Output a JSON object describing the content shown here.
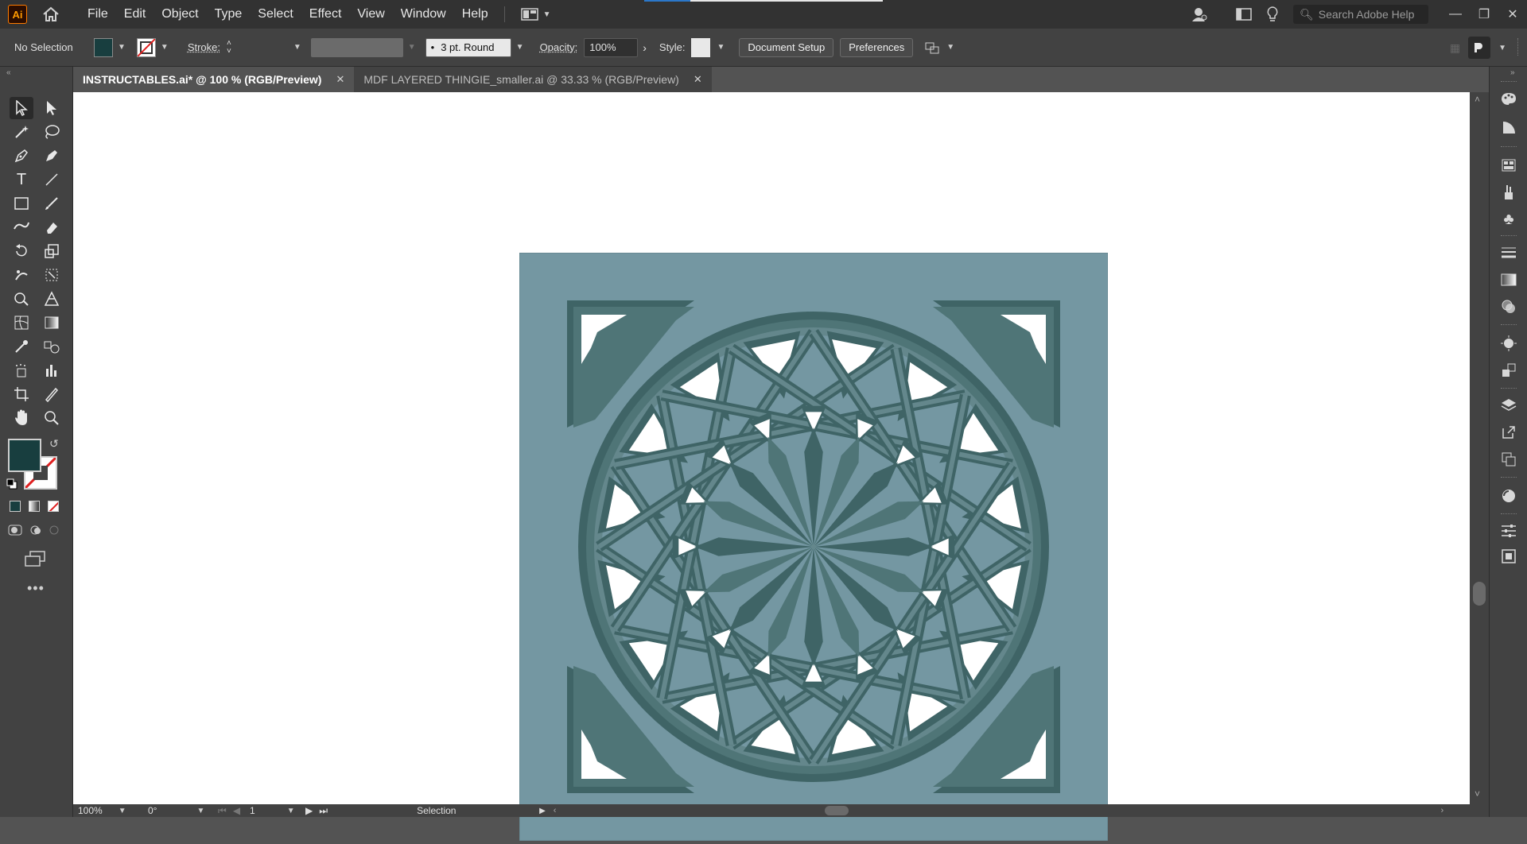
{
  "app": {
    "logo_text": "Ai"
  },
  "menu": [
    "File",
    "Edit",
    "Object",
    "Type",
    "Select",
    "Effect",
    "View",
    "Window",
    "Help"
  ],
  "search": {
    "placeholder": "Search Adobe Help"
  },
  "control_bar": {
    "selection_status": "No Selection",
    "stroke_label": "Stroke:",
    "brush_label": "3 pt. Round",
    "opacity_label": "Opacity:",
    "opacity_value": "100%",
    "style_label": "Style:",
    "document_setup": "Document Setup",
    "preferences": "Preferences"
  },
  "tabs": [
    {
      "label": "INSTRUCTABLES.ai* @ 100 % (RGB/Preview)",
      "active": true
    },
    {
      "label": "MDF LAYERED THINGIE_smaller.ai @ 33.33 % (RGB/Preview)",
      "active": false
    }
  ],
  "status_bar": {
    "zoom": "100%",
    "rotation": "0°",
    "artboard_number": "1",
    "tool_name": "Selection"
  },
  "colors": {
    "fill": "#183e3f",
    "artboard_bg": "#7497a2",
    "pattern_dark": "#3f6466",
    "pattern_mid": "#4f7577",
    "pattern_light": "#64878c"
  }
}
